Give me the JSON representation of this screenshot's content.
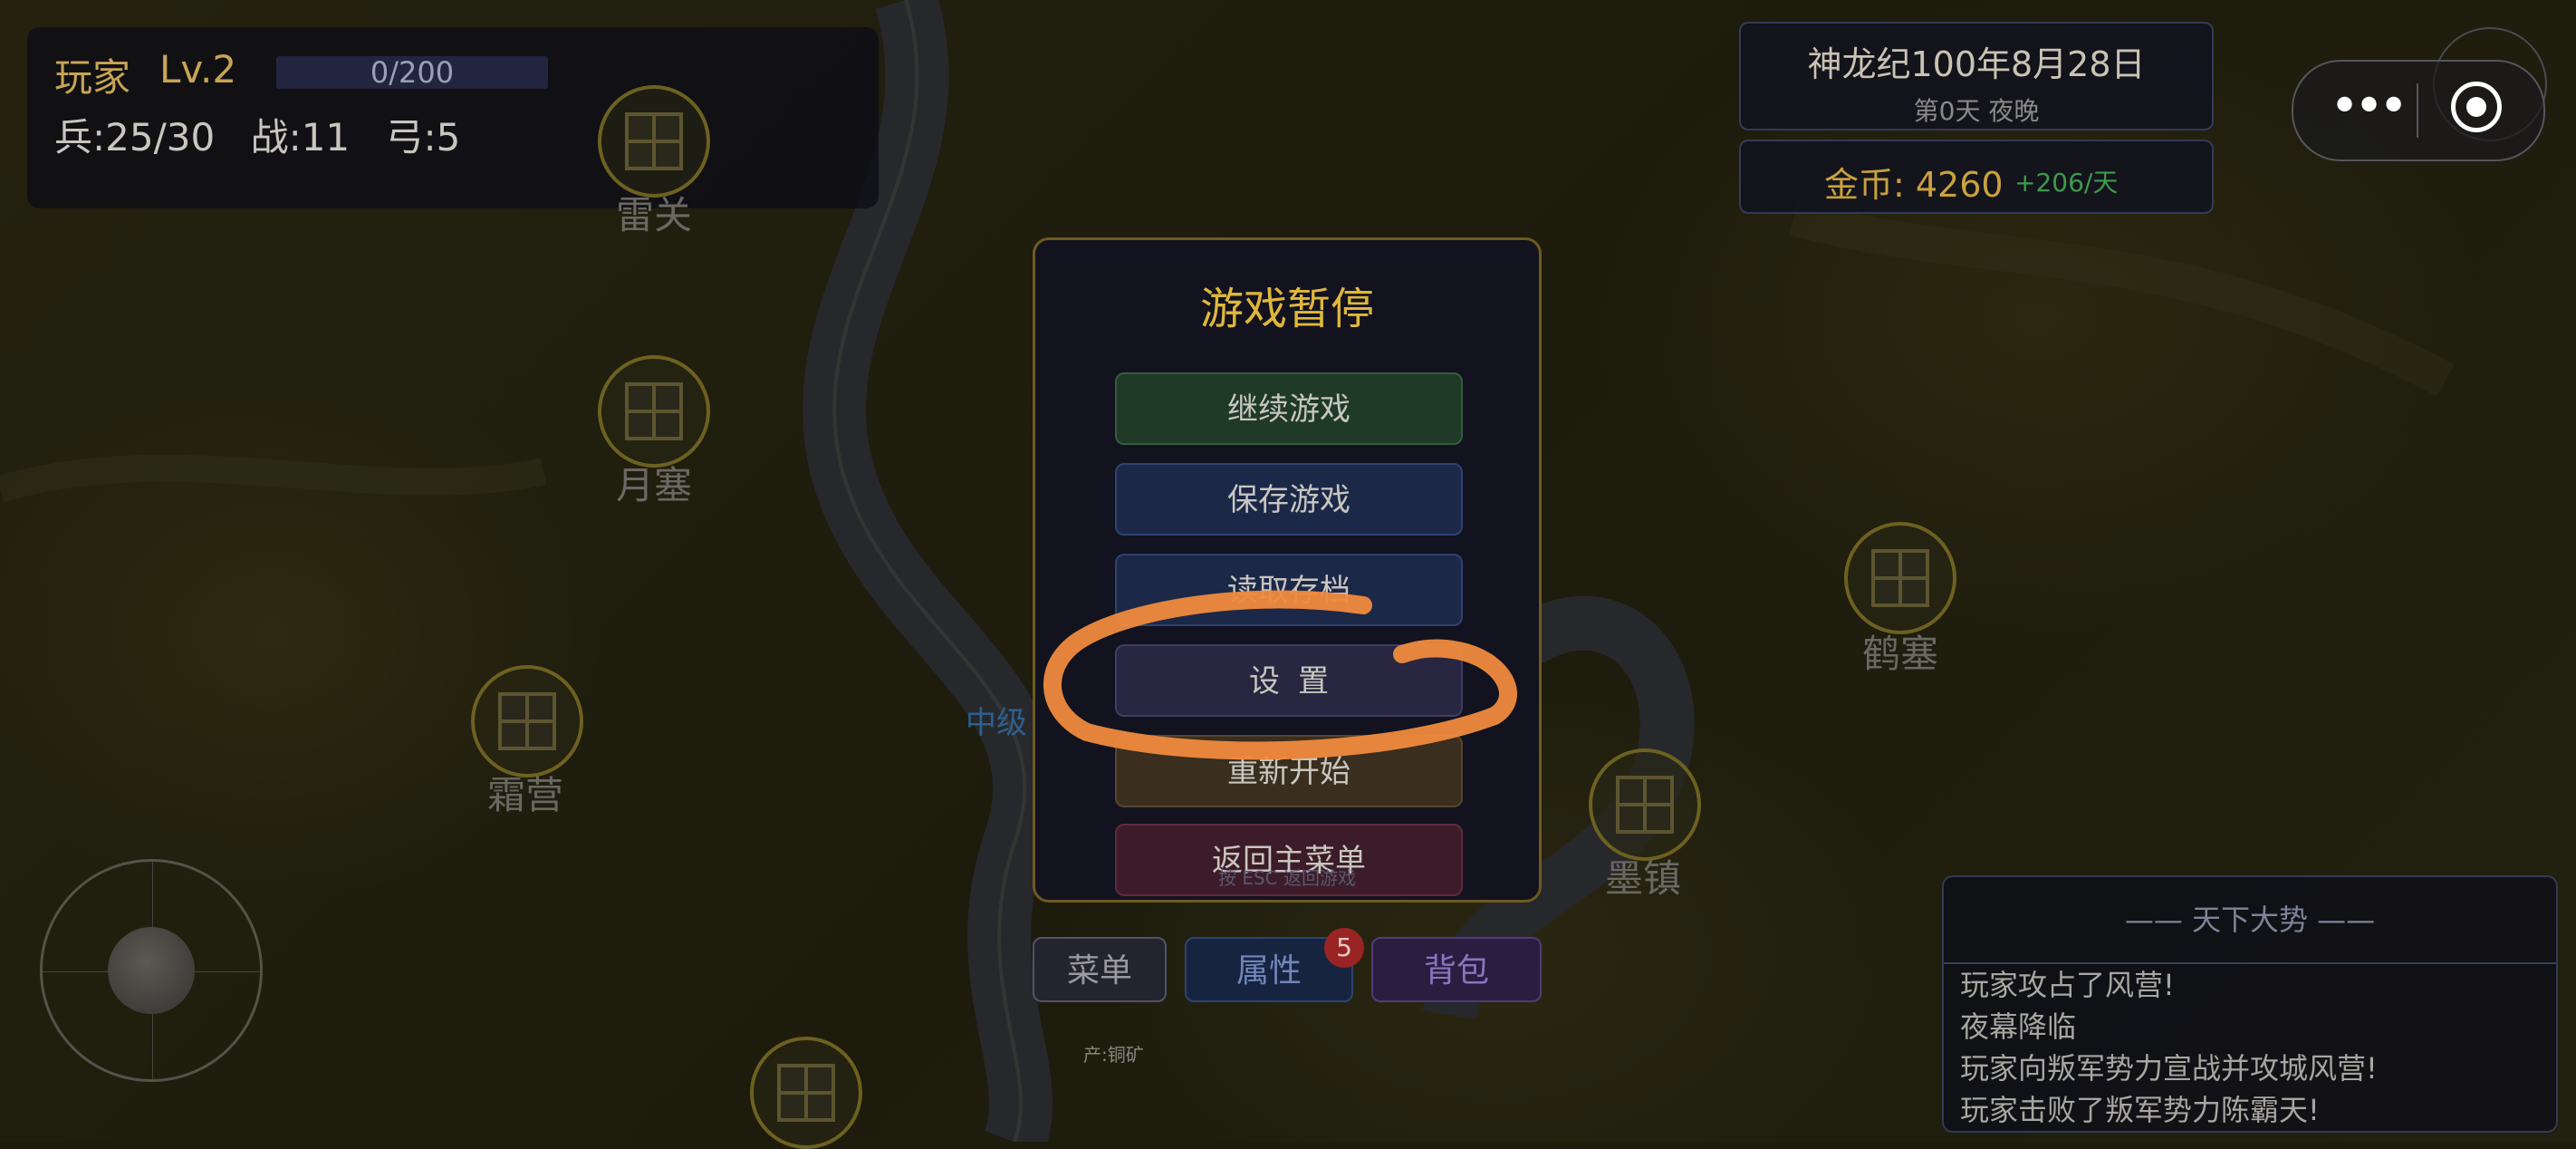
{
  "player": {
    "name": "玩家",
    "level": "Lv.2",
    "xp": "0/200",
    "xp_fraction": 0,
    "soldiers": "兵:25/30",
    "warriors": "战:11",
    "archers": "弓:5"
  },
  "calendar": {
    "date": "神龙纪100年8月28日",
    "day_time": "第0天  夜晚"
  },
  "economy": {
    "gold": "金币: 4260",
    "gold_rate": "+206/天"
  },
  "cities": [
    {
      "name": "雷关"
    },
    {
      "name": "月塞"
    },
    {
      "name": "霜营"
    },
    {
      "name": "鹤塞"
    },
    {
      "name": "墨镇"
    }
  ],
  "map_tag": "中级",
  "pause_menu": {
    "title": "游戏暂停",
    "continue": "继续游戏",
    "save": "保存游戏",
    "load": "读取存档",
    "settings": "设置",
    "restart": "重新开始",
    "main_menu": "返回主菜单",
    "esc_hint": "按 ESC 返回游戏"
  },
  "bottom_bar": {
    "menu": "菜单",
    "attributes": "属性",
    "attributes_badge": "5",
    "bag": "背包",
    "ore_label": "产:铜矿"
  },
  "news": {
    "title": "—— 天下大势 ——",
    "items": [
      "玩家攻占了风营!",
      "夜幕降临",
      "玩家向叛军势力宣战并攻城风营!",
      "玩家击败了叛军势力陈霸天!"
    ]
  },
  "colors": {
    "gold": "#e0b73c",
    "annotation": "#f08a3e",
    "gold_rate": "#3d9b4b"
  }
}
